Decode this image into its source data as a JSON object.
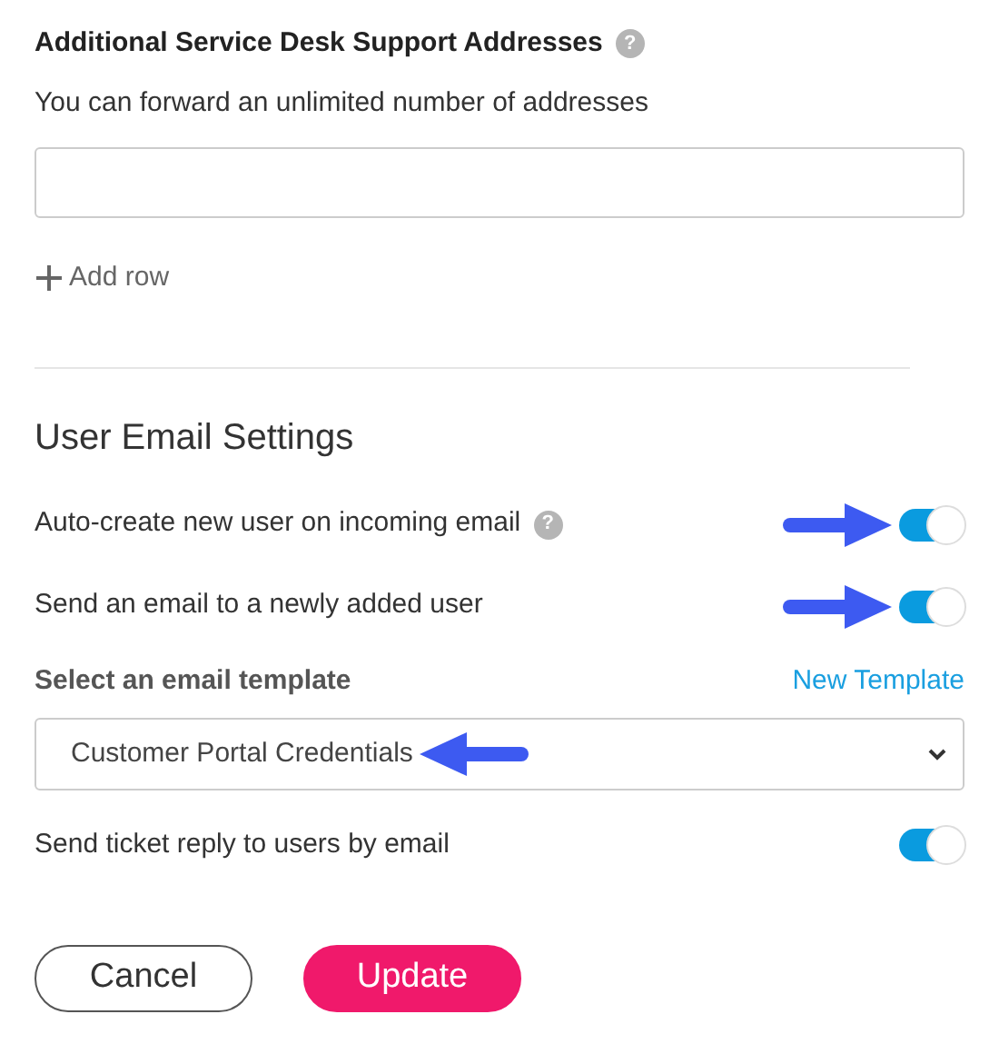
{
  "addresses": {
    "title": "Additional Service Desk Support Addresses",
    "help": "?",
    "subtitle": "You can forward an unlimited number of addresses",
    "add_row": "Add row"
  },
  "user_email_settings": {
    "heading": "User Email Settings",
    "settings": [
      {
        "kind": "toggle",
        "label": "Auto-create new user on incoming email",
        "help": "?",
        "on": true,
        "arrow": true
      },
      {
        "kind": "toggle",
        "label": "Send an email to a newly added user",
        "on": true,
        "arrow": true
      },
      {
        "kind": "select",
        "label": "Select an email template",
        "link": "New Template",
        "value": "Customer Portal Credentials",
        "arrow": true
      },
      {
        "kind": "toggle",
        "label": "Send ticket reply to users by email",
        "on": true,
        "arrow": false
      }
    ]
  },
  "buttons": [
    {
      "kind": "secondary",
      "label": "Cancel"
    },
    {
      "kind": "primary",
      "label": "Update"
    }
  ]
}
